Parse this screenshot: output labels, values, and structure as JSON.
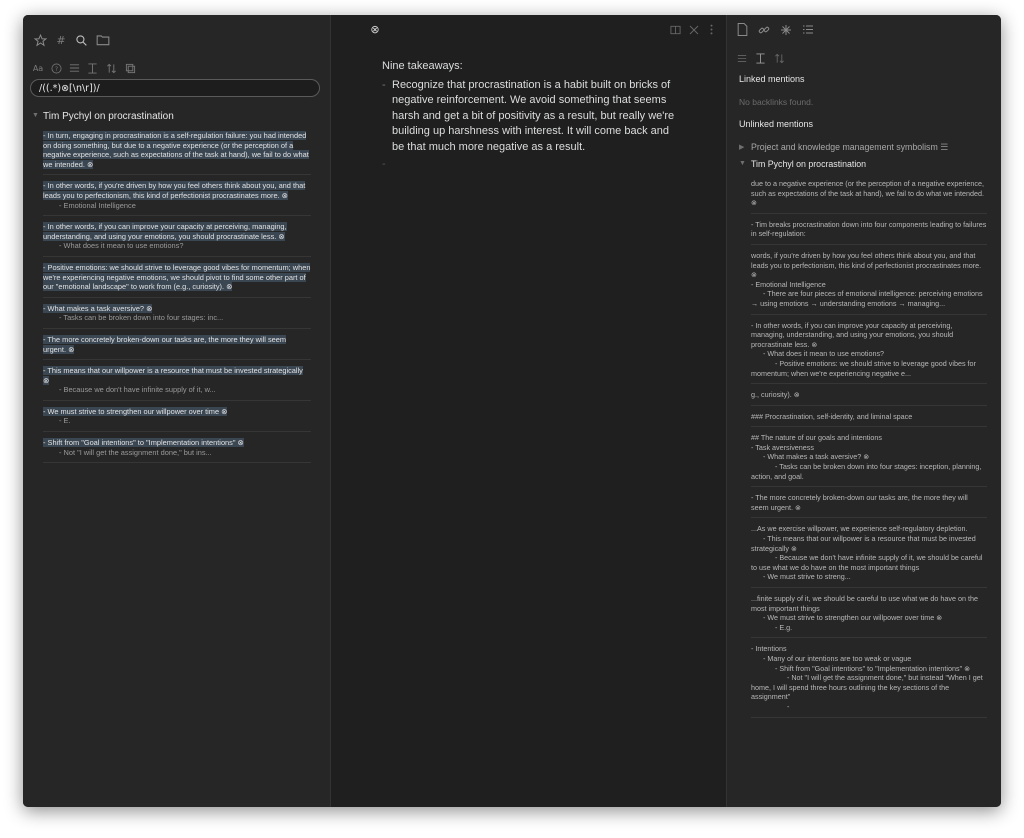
{
  "left": {
    "search_query": "/((.*)⊗[\\n\\r])/",
    "group_title": "Tim Pychyl on procrastination",
    "results": [
      {
        "hl": "- In turn, engaging in procrastination is a self-regulation failure: you had intended on doing something, but due to a negative experience (or the perception of a negative experience, such as expectations of the task at hand), we fail to do what we intended. ⊗",
        "sub": ""
      },
      {
        "hl": "- In other words, if you're driven by how you feel others think about you, and that leads you to perfectionism, this kind of perfectionist procrastinates more. ⊗",
        "sub": "- Emotional Intelligence"
      },
      {
        "hl": "- In other words, if you can improve your capacity at perceiving, managing, understanding, and using your emotions, you should procrastinate less. ⊗",
        "sub": "- What does it mean to use emotions?"
      },
      {
        "hl": "- Positive emotions: we should strive to leverage good vibes for momentum; when we're experiencing negative emotions, we should pivot to find some other part of our \"emotional landscape\" to work from (e.g., curiosity). ⊗",
        "sub": ""
      },
      {
        "hl": "- What makes a task aversive? ⊗",
        "sub": "- Tasks can be broken down into four stages: inc..."
      },
      {
        "hl": "- The more concretely broken-down our tasks are, the more they will seem urgent. ⊗",
        "sub": ""
      },
      {
        "hl": "- This means that our willpower is a resource that must be invested strategically ⊗",
        "sub": "- Because we don't have infinite supply of it, w..."
      },
      {
        "hl": "- We must strive to strengthen our willpower over time ⊗",
        "sub": "- E."
      },
      {
        "hl": "- Shift from \"Goal intentions\" to \"Implementation intentions\" ⊗",
        "sub": "- Not \"I will get the assignment done,\" but ins..."
      }
    ]
  },
  "middle": {
    "close_glyph": "⊗",
    "heading": "Nine takeaways:",
    "paragraph": "Recognize that procrastination is a habit built on bricks of negative reinforcement. We avoid something that seems harsh and get a bit of positivity as a result, but really we're building up harshness with interest. It will come back and be that much more negative as a result.",
    "bullet": "-"
  },
  "right": {
    "linked_mentions": "Linked mentions",
    "no_backlinks": "No backlinks found.",
    "unlinked_mentions": "Unlinked mentions",
    "group_1": "Project and knowledge management symbolism",
    "group_2": "Tim Pychyl on procrastination",
    "blocks": [
      "due to a negative experience (or the perception of a negative experience, such as expectations of the task at hand), we fail to do what we intended. ⊗",
      "- Tim breaks procrastination down into four components leading to failures in self-regulation:",
      "words, if you're driven by how you feel others think about you, and that leads you to perfectionism, this kind of perfectionist procrastinates more. ⊗\n- Emotional Intelligence\n      - There are four pieces of emotional intelligence: perceiving emotions → using emotions → understanding emotions → managing...",
      "- In other words, if you can improve your capacity at perceiving, managing, understanding, and using your emotions, you should procrastinate less. ⊗\n      - What does it mean to use emotions?\n            - Positive emotions: we should strive to leverage good vibes for momentum; when we're experiencing negative e...",
      "g., curiosity). ⊗",
      "### Procrastination, self-identity, and liminal space",
      "## The nature of our goals and intentions\n- Task aversiveness\n      - What makes a task aversive? ⊗\n            - Tasks can be broken down into four stages: inception, planning, action, and goal.",
      "- The more concretely broken-down our tasks are, the more they will seem urgent. ⊗",
      "...As we exercise willpower, we experience self-regulatory depletion.\n      - This means that our willpower is a resource that must be invested strategically ⊗\n            - Because we don't have infinite supply of it, we should be careful to use what we do have on the most important things\n      - We must strive to streng...",
      "...finite supply of it, we should be careful to use what we do have on the most important things\n      - We must strive to strengthen our willpower over time ⊗\n            - E.g.",
      "- Intentions\n      - Many of our intentions are too weak or vague\n            - Shift from \"Goal intentions\" to \"Implementation intentions\" ⊗\n                  - Not \"I will get the assignment done,\" but instead \"When I get home, I will spend three hours outlining the key sections of the assignment\"\n                  -"
    ]
  }
}
